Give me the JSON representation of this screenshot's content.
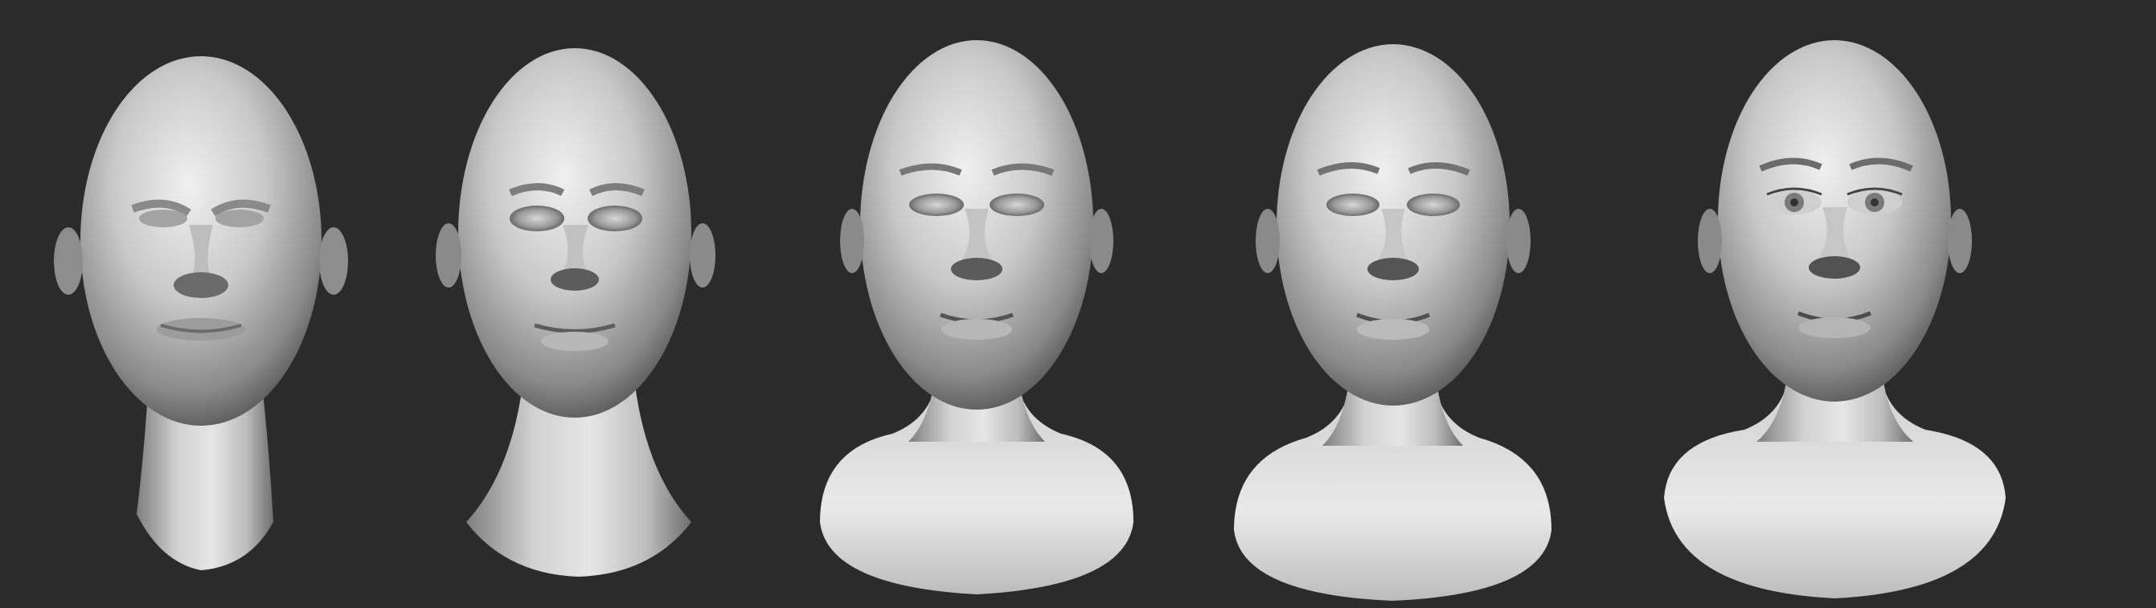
{
  "canvas": {
    "background": "#2b2b2b",
    "description_colors": {
      "clay_light": "#e8e8e8",
      "clay_mid": "#a9a9a9",
      "clay_dark": "#4a4a4a"
    }
  },
  "sculpt_stages": [
    {
      "id": "stage-1",
      "detail": "blockout"
    },
    {
      "id": "stage-2",
      "detail": "primary-forms"
    },
    {
      "id": "stage-3",
      "detail": "secondary-forms"
    },
    {
      "id": "stage-4",
      "detail": "refined"
    },
    {
      "id": "stage-5",
      "detail": "final-with-eyes"
    }
  ]
}
